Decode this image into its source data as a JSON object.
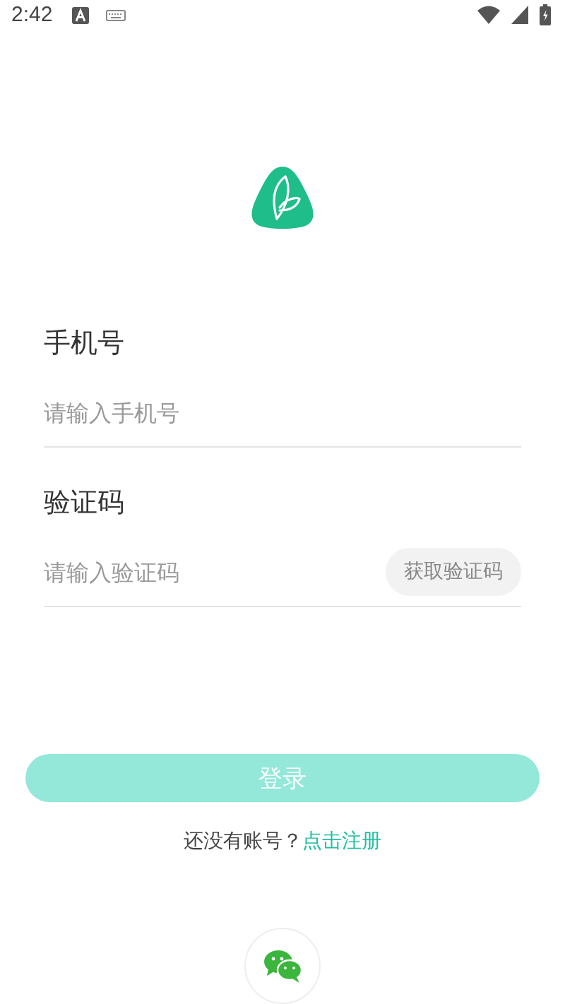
{
  "status_bar": {
    "time": "2:42"
  },
  "phone": {
    "label": "手机号",
    "placeholder": "请输入手机号"
  },
  "code": {
    "label": "验证码",
    "placeholder": "请输入验证码",
    "send_button": "获取验证码"
  },
  "login_button": {
    "label": "登录",
    "disabled": true
  },
  "register": {
    "prompt": "还没有账号？",
    "link": "点击注册"
  }
}
